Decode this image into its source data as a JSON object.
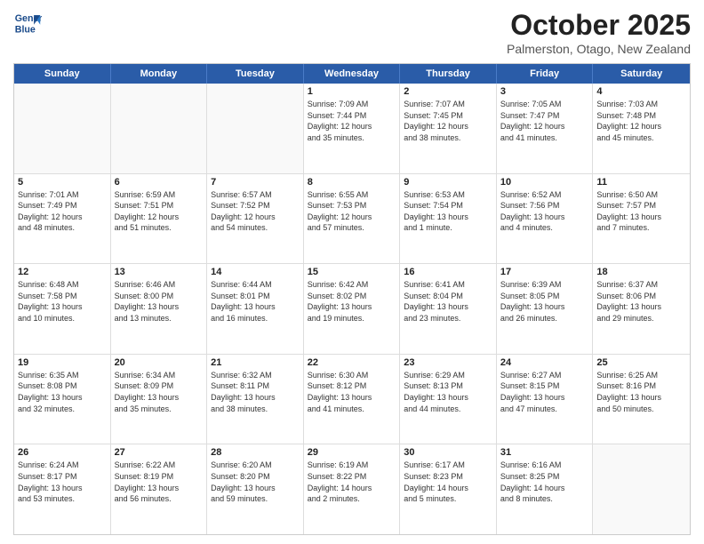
{
  "logo": {
    "line1": "General",
    "line2": "Blue"
  },
  "header": {
    "month": "October 2025",
    "location": "Palmerston, Otago, New Zealand"
  },
  "days": [
    "Sunday",
    "Monday",
    "Tuesday",
    "Wednesday",
    "Thursday",
    "Friday",
    "Saturday"
  ],
  "weeks": [
    [
      {
        "day": "",
        "content": ""
      },
      {
        "day": "",
        "content": ""
      },
      {
        "day": "",
        "content": ""
      },
      {
        "day": "1",
        "content": "Sunrise: 7:09 AM\nSunset: 7:44 PM\nDaylight: 12 hours\nand 35 minutes."
      },
      {
        "day": "2",
        "content": "Sunrise: 7:07 AM\nSunset: 7:45 PM\nDaylight: 12 hours\nand 38 minutes."
      },
      {
        "day": "3",
        "content": "Sunrise: 7:05 AM\nSunset: 7:47 PM\nDaylight: 12 hours\nand 41 minutes."
      },
      {
        "day": "4",
        "content": "Sunrise: 7:03 AM\nSunset: 7:48 PM\nDaylight: 12 hours\nand 45 minutes."
      }
    ],
    [
      {
        "day": "5",
        "content": "Sunrise: 7:01 AM\nSunset: 7:49 PM\nDaylight: 12 hours\nand 48 minutes."
      },
      {
        "day": "6",
        "content": "Sunrise: 6:59 AM\nSunset: 7:51 PM\nDaylight: 12 hours\nand 51 minutes."
      },
      {
        "day": "7",
        "content": "Sunrise: 6:57 AM\nSunset: 7:52 PM\nDaylight: 12 hours\nand 54 minutes."
      },
      {
        "day": "8",
        "content": "Sunrise: 6:55 AM\nSunset: 7:53 PM\nDaylight: 12 hours\nand 57 minutes."
      },
      {
        "day": "9",
        "content": "Sunrise: 6:53 AM\nSunset: 7:54 PM\nDaylight: 13 hours\nand 1 minute."
      },
      {
        "day": "10",
        "content": "Sunrise: 6:52 AM\nSunset: 7:56 PM\nDaylight: 13 hours\nand 4 minutes."
      },
      {
        "day": "11",
        "content": "Sunrise: 6:50 AM\nSunset: 7:57 PM\nDaylight: 13 hours\nand 7 minutes."
      }
    ],
    [
      {
        "day": "12",
        "content": "Sunrise: 6:48 AM\nSunset: 7:58 PM\nDaylight: 13 hours\nand 10 minutes."
      },
      {
        "day": "13",
        "content": "Sunrise: 6:46 AM\nSunset: 8:00 PM\nDaylight: 13 hours\nand 13 minutes."
      },
      {
        "day": "14",
        "content": "Sunrise: 6:44 AM\nSunset: 8:01 PM\nDaylight: 13 hours\nand 16 minutes."
      },
      {
        "day": "15",
        "content": "Sunrise: 6:42 AM\nSunset: 8:02 PM\nDaylight: 13 hours\nand 19 minutes."
      },
      {
        "day": "16",
        "content": "Sunrise: 6:41 AM\nSunset: 8:04 PM\nDaylight: 13 hours\nand 23 minutes."
      },
      {
        "day": "17",
        "content": "Sunrise: 6:39 AM\nSunset: 8:05 PM\nDaylight: 13 hours\nand 26 minutes."
      },
      {
        "day": "18",
        "content": "Sunrise: 6:37 AM\nSunset: 8:06 PM\nDaylight: 13 hours\nand 29 minutes."
      }
    ],
    [
      {
        "day": "19",
        "content": "Sunrise: 6:35 AM\nSunset: 8:08 PM\nDaylight: 13 hours\nand 32 minutes."
      },
      {
        "day": "20",
        "content": "Sunrise: 6:34 AM\nSunset: 8:09 PM\nDaylight: 13 hours\nand 35 minutes."
      },
      {
        "day": "21",
        "content": "Sunrise: 6:32 AM\nSunset: 8:11 PM\nDaylight: 13 hours\nand 38 minutes."
      },
      {
        "day": "22",
        "content": "Sunrise: 6:30 AM\nSunset: 8:12 PM\nDaylight: 13 hours\nand 41 minutes."
      },
      {
        "day": "23",
        "content": "Sunrise: 6:29 AM\nSunset: 8:13 PM\nDaylight: 13 hours\nand 44 minutes."
      },
      {
        "day": "24",
        "content": "Sunrise: 6:27 AM\nSunset: 8:15 PM\nDaylight: 13 hours\nand 47 minutes."
      },
      {
        "day": "25",
        "content": "Sunrise: 6:25 AM\nSunset: 8:16 PM\nDaylight: 13 hours\nand 50 minutes."
      }
    ],
    [
      {
        "day": "26",
        "content": "Sunrise: 6:24 AM\nSunset: 8:17 PM\nDaylight: 13 hours\nand 53 minutes."
      },
      {
        "day": "27",
        "content": "Sunrise: 6:22 AM\nSunset: 8:19 PM\nDaylight: 13 hours\nand 56 minutes."
      },
      {
        "day": "28",
        "content": "Sunrise: 6:20 AM\nSunset: 8:20 PM\nDaylight: 13 hours\nand 59 minutes."
      },
      {
        "day": "29",
        "content": "Sunrise: 6:19 AM\nSunset: 8:22 PM\nDaylight: 14 hours\nand 2 minutes."
      },
      {
        "day": "30",
        "content": "Sunrise: 6:17 AM\nSunset: 8:23 PM\nDaylight: 14 hours\nand 5 minutes."
      },
      {
        "day": "31",
        "content": "Sunrise: 6:16 AM\nSunset: 8:25 PM\nDaylight: 14 hours\nand 8 minutes."
      },
      {
        "day": "",
        "content": ""
      }
    ]
  ]
}
